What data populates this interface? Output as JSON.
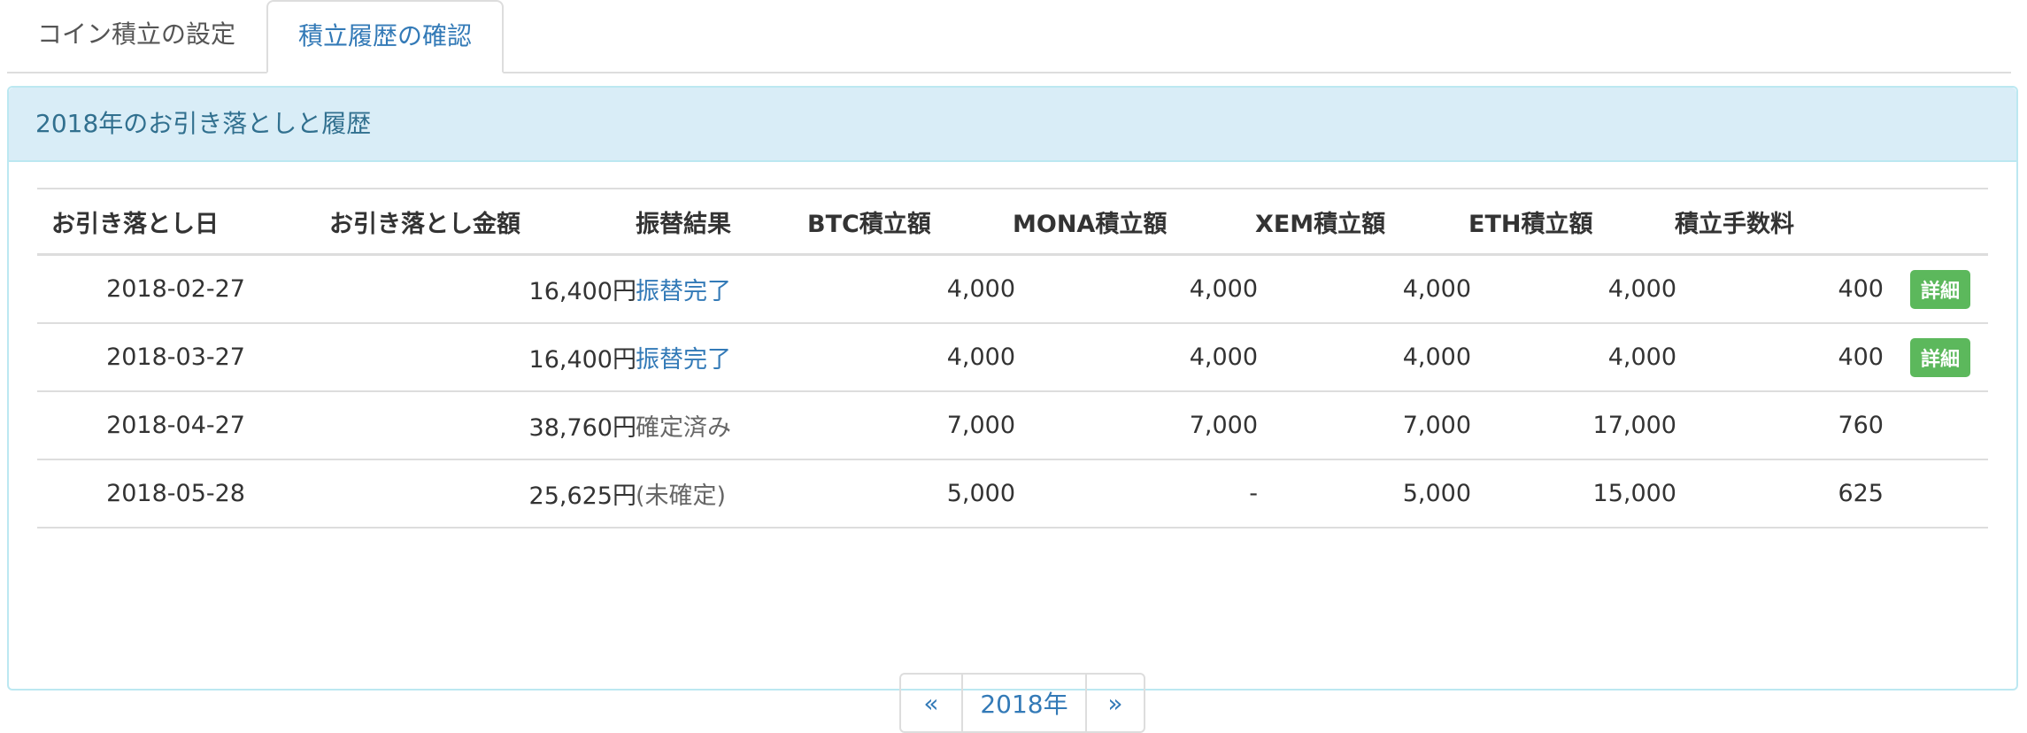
{
  "tabs": [
    {
      "label": "コイン積立の設定",
      "active": false
    },
    {
      "label": "積立履歴の確認",
      "active": true
    }
  ],
  "panel": {
    "title": "2018年のお引き落としと履歴"
  },
  "table": {
    "headers": [
      "お引き落とし日",
      "お引き落とし金額",
      "振替結果",
      "BTC積立額",
      "MONA積立額",
      "XEM積立額",
      "ETH積立額",
      "積立手数料"
    ],
    "rows": [
      {
        "date": "2018-02-27",
        "amount": "16,400円",
        "result": "振替完了",
        "btc": "4,000",
        "mona": "4,000",
        "xem": "4,000",
        "eth": "4,000",
        "fee": "400",
        "detail": "詳細"
      },
      {
        "date": "2018-03-27",
        "amount": "16,400円",
        "result": "振替完了",
        "btc": "4,000",
        "mona": "4,000",
        "xem": "4,000",
        "eth": "4,000",
        "fee": "400",
        "detail": "詳細"
      },
      {
        "date": "2018-04-27",
        "amount": "38,760円",
        "result": "確定済み",
        "btc": "7,000",
        "mona": "7,000",
        "xem": "7,000",
        "eth": "17,000",
        "fee": "760"
      },
      {
        "date": "2018-05-28",
        "amount": "25,625円",
        "result": "(未確定)",
        "btc": "5,000",
        "mona": "-",
        "xem": "5,000",
        "eth": "15,000",
        "fee": "625"
      }
    ]
  },
  "pager": {
    "prev": "«",
    "current": "2018年",
    "next": "»"
  },
  "colors": {
    "link": "#337ab7",
    "panel_heading_bg": "#d9edf7",
    "panel_border": "#bce8f1",
    "detail_button": "#5cb85c"
  }
}
